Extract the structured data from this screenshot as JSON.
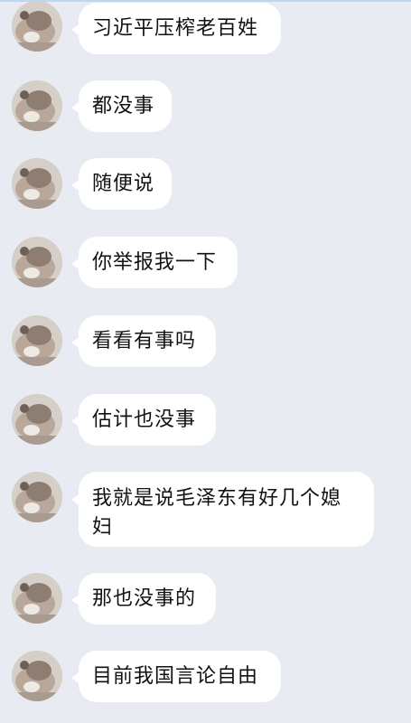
{
  "messages": [
    {
      "text": "习近平压榨老百姓",
      "avatar": "cat-avatar"
    },
    {
      "text": "都没事",
      "avatar": "cat-avatar"
    },
    {
      "text": "随便说",
      "avatar": "cat-avatar"
    },
    {
      "text": "你举报我一下",
      "avatar": "cat-avatar"
    },
    {
      "text": "看看有事吗",
      "avatar": "cat-avatar"
    },
    {
      "text": "估计也没事",
      "avatar": "cat-avatar"
    },
    {
      "text": "我就是说毛泽东有好几个媳妇",
      "avatar": "cat-avatar"
    },
    {
      "text": "那也没事的",
      "avatar": "cat-avatar"
    },
    {
      "text": "目前我国言论自由",
      "avatar": "cat-avatar"
    }
  ],
  "colors": {
    "background": "#e9ebf3",
    "bubble": "#ffffff",
    "text": "#111111",
    "top_border": "#b9d9f1"
  }
}
